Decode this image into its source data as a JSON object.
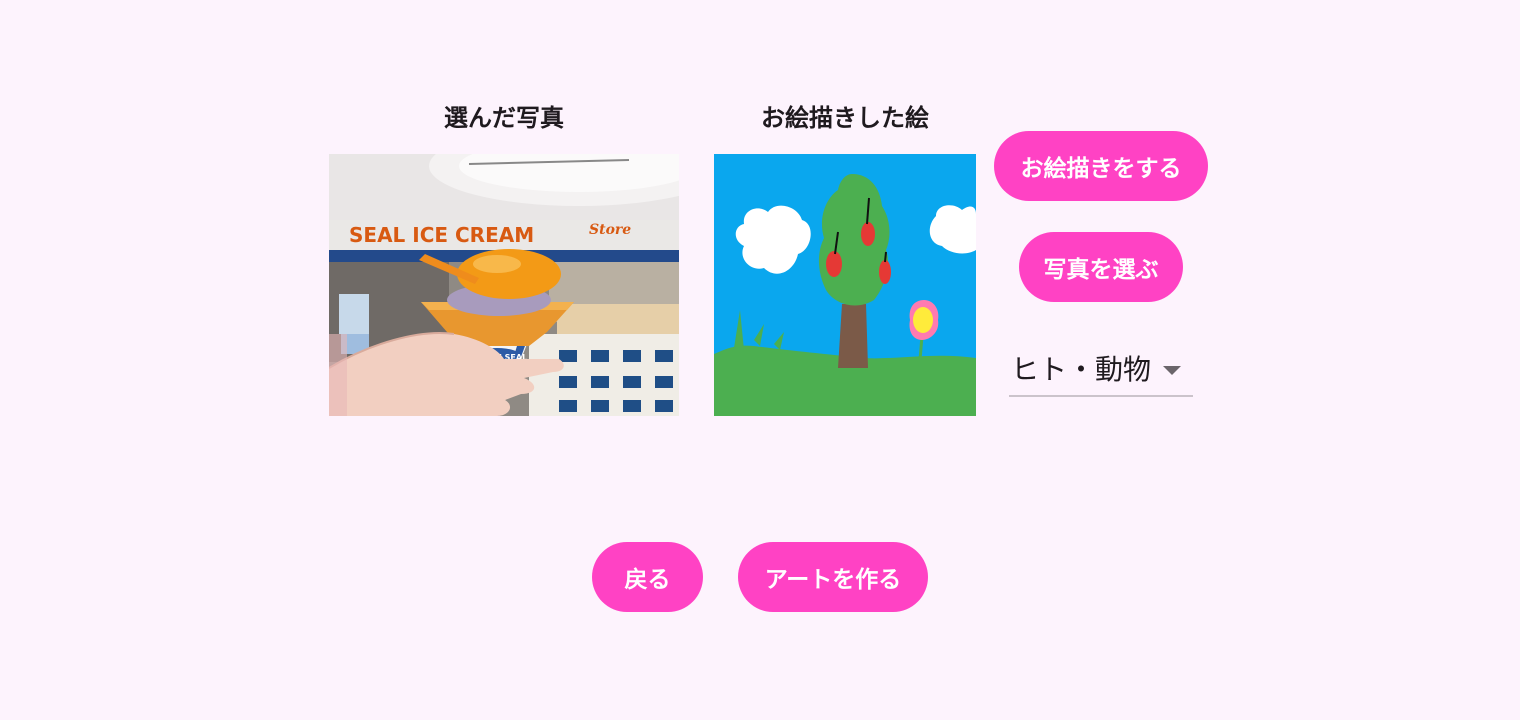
{
  "selected_photo": {
    "caption": "選んだ写真",
    "sign_text": "SEAL ICE CREAM",
    "sign_text_right": "Store",
    "cone_label": "BLUE SEAL"
  },
  "drawing": {
    "caption": "お絵描きした絵"
  },
  "buttons": {
    "draw": "お絵描きをする",
    "choose_photo": "写真を選ぶ",
    "back": "戻る",
    "make_art": "アートを作る"
  },
  "category_select": {
    "value": "ヒト・動物"
  },
  "colors": {
    "background": "#fdf3fd",
    "accent": "#ff42c4",
    "sky": "#0aa7ee",
    "grass": "#4caf50"
  }
}
